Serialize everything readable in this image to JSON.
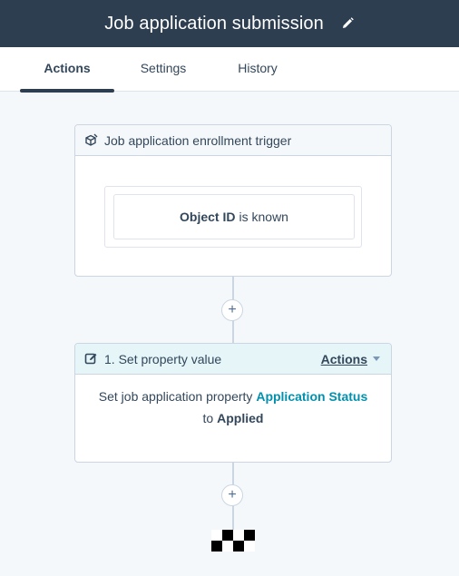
{
  "header": {
    "title": "Job application submission",
    "edit_icon": "pencil-icon"
  },
  "tabs": [
    {
      "label": "Actions",
      "active": true
    },
    {
      "label": "Settings",
      "active": false
    },
    {
      "label": "History",
      "active": false
    }
  ],
  "trigger": {
    "icon": "enrollment-trigger-icon",
    "title": "Job application enrollment trigger",
    "filter": {
      "property": "Object ID",
      "condition": "is known"
    }
  },
  "action": {
    "icon": "edit-property-icon",
    "title": "1. Set property value",
    "menu_label": "Actions",
    "body_prefix": "Set job application property",
    "property": "Application Status",
    "to_word": "to",
    "value": "Applied"
  },
  "add_button_symbol": "+",
  "end_icon": "checkered-flag-icon",
  "colors": {
    "header_bg": "#2d3e50",
    "link": "#0091ae",
    "action_head_bg": "#e5f5f8",
    "canvas_bg": "#f5f8fa"
  }
}
